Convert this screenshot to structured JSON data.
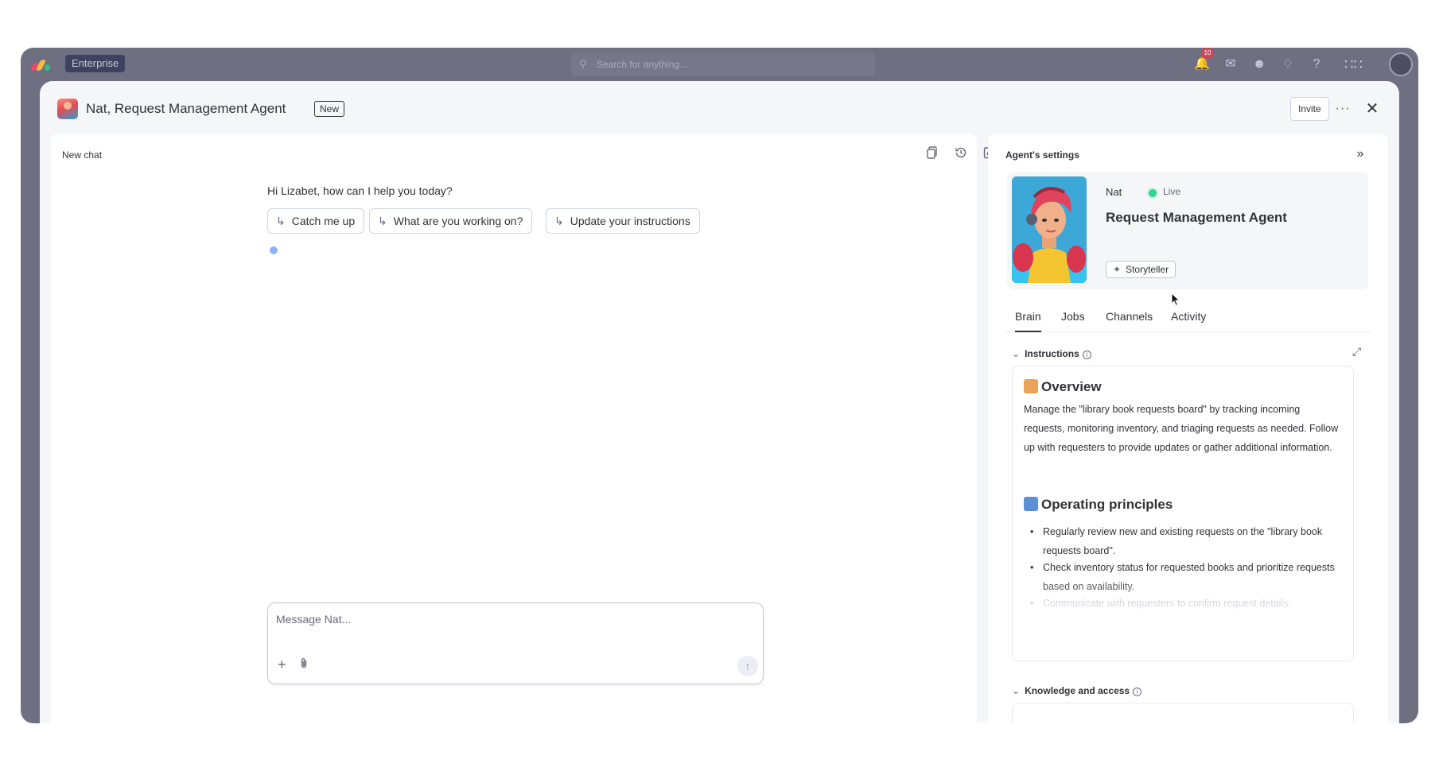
{
  "background_app": {
    "plan_badge": "Enterprise",
    "search_placeholder": "Search for anything...",
    "notification_count": "10",
    "icons": [
      "bell-icon",
      "inbox-icon",
      "invite-members-icon",
      "integrations-icon",
      "help-icon",
      "apps-grid-icon",
      "avatar"
    ]
  },
  "modal": {
    "title": "Nat, Request Management Agent",
    "badge": "New",
    "invite_label": "Invite",
    "more_icon": "more-icon",
    "close_icon": "close-icon"
  },
  "chat": {
    "title": "New chat",
    "greeting": "Hi Lizabet, how can I help you today?",
    "suggestions": [
      {
        "label": "Catch me up"
      },
      {
        "label": "What are you working on?"
      },
      {
        "label": "Update your instructions"
      }
    ],
    "input_placeholder": "Message Nat...",
    "tools": [
      "copy-icon",
      "history-icon",
      "new-chat-icon"
    ]
  },
  "settings": {
    "title": "Agent's settings",
    "agent": {
      "name": "Nat",
      "status": "Live",
      "role": "Request Management Agent",
      "persona": "Storyteller"
    },
    "tabs": [
      {
        "label": "Brain",
        "active": true
      },
      {
        "label": "Jobs",
        "active": false
      },
      {
        "label": "Channels",
        "active": false
      },
      {
        "label": "Activity",
        "active": false
      }
    ],
    "instructions": {
      "label": "Instructions",
      "overview_heading": "Overview",
      "overview_text": "Manage the \"library book requests board\" by tracking incoming requests, monitoring inventory, and triaging requests as needed. Follow up with requesters to provide updates or gather additional information.",
      "principles_heading": "Operating principles",
      "principles": [
        "Regularly review new and existing requests on the \"library book requests board\".",
        "Check inventory status for requested books and prioritize requests based on availability.",
        "Communicate with requesters to confirm request details."
      ]
    },
    "knowledge_label": "Knowledge and access"
  },
  "colors": {
    "backdrop": "#6e6f81",
    "panel": "#ffffff",
    "modal_bg": "#f5f6f8",
    "live": "#33d391",
    "text": "#323338"
  }
}
